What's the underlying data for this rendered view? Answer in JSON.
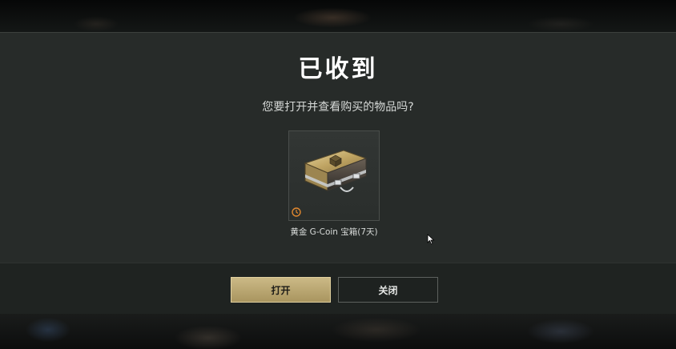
{
  "dialog": {
    "title": "已收到",
    "question": "您要打开并查看购买的物品吗?",
    "item": {
      "name": "黄金 G-Coin 宝箱(7天)",
      "icon": "gold-gcoin-crate-icon",
      "timer_icon": "clock-icon"
    }
  },
  "buttons": {
    "open_label": "打开",
    "close_label": "关闭"
  },
  "colors": {
    "accent_gold": "#c4b27e",
    "panel_bg": "#272b29",
    "footer_bg": "#1f2321"
  }
}
